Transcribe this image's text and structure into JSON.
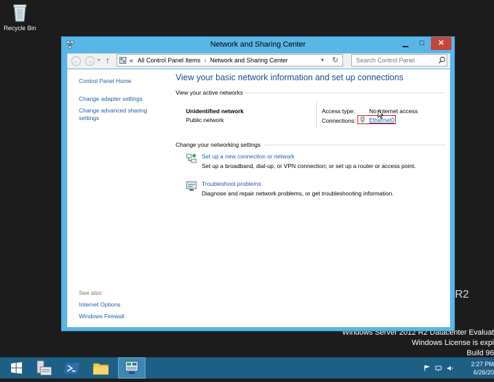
{
  "desktop": {
    "recycle_bin_label": "Recycle Bin",
    "watermark_r2": "R2",
    "watermark_line1": "Windows Server 2012 R2 Datacenter Evaluat",
    "watermark_line2": "Windows License is expi",
    "watermark_line3": "Build 96"
  },
  "window": {
    "title": "Network and Sharing Center",
    "buttons": {
      "minimize": "▁",
      "maximize": "□",
      "close": "✕"
    },
    "address": {
      "prefix": "«",
      "crumbs": [
        "All Control Panel Items",
        "Network and Sharing Center"
      ],
      "separator": "›"
    },
    "search_placeholder": "Search Control Panel"
  },
  "sidebar": {
    "home": "Control Panel Home",
    "links": [
      "Change adapter settings",
      "Change advanced sharing settings"
    ],
    "see_also_label": "See also",
    "see_also": [
      "Internet Options",
      "Windows Firewall"
    ]
  },
  "main": {
    "heading": "View your basic network information and set up connections",
    "active_networks_label": "View your active networks",
    "network": {
      "name": "Unidentified network",
      "type": "Public network",
      "access_type_label": "Access type:",
      "access_type_value": "No Internet access",
      "connections_label": "Connections:",
      "connection_value": "Ethernet0"
    },
    "change_label": "Change your networking settings",
    "tasks": [
      {
        "link": "Set up a new connection or network",
        "description": "Set up a broadband, dial-up, or VPN connection; or set up a router or access point."
      },
      {
        "link": "Troubleshoot problems",
        "description": "Diagnose and repair network problems, or get troubleshooting information."
      }
    ]
  },
  "taskbar": {
    "time": "2:27 PM",
    "date": "6/26/20"
  },
  "colors": {
    "window_frame": "#59b7e8",
    "link": "#1f5ca8",
    "highlight_box": "#d21c1c",
    "taskbar": "#1e5f85",
    "desktop": "#1c1c1c"
  }
}
